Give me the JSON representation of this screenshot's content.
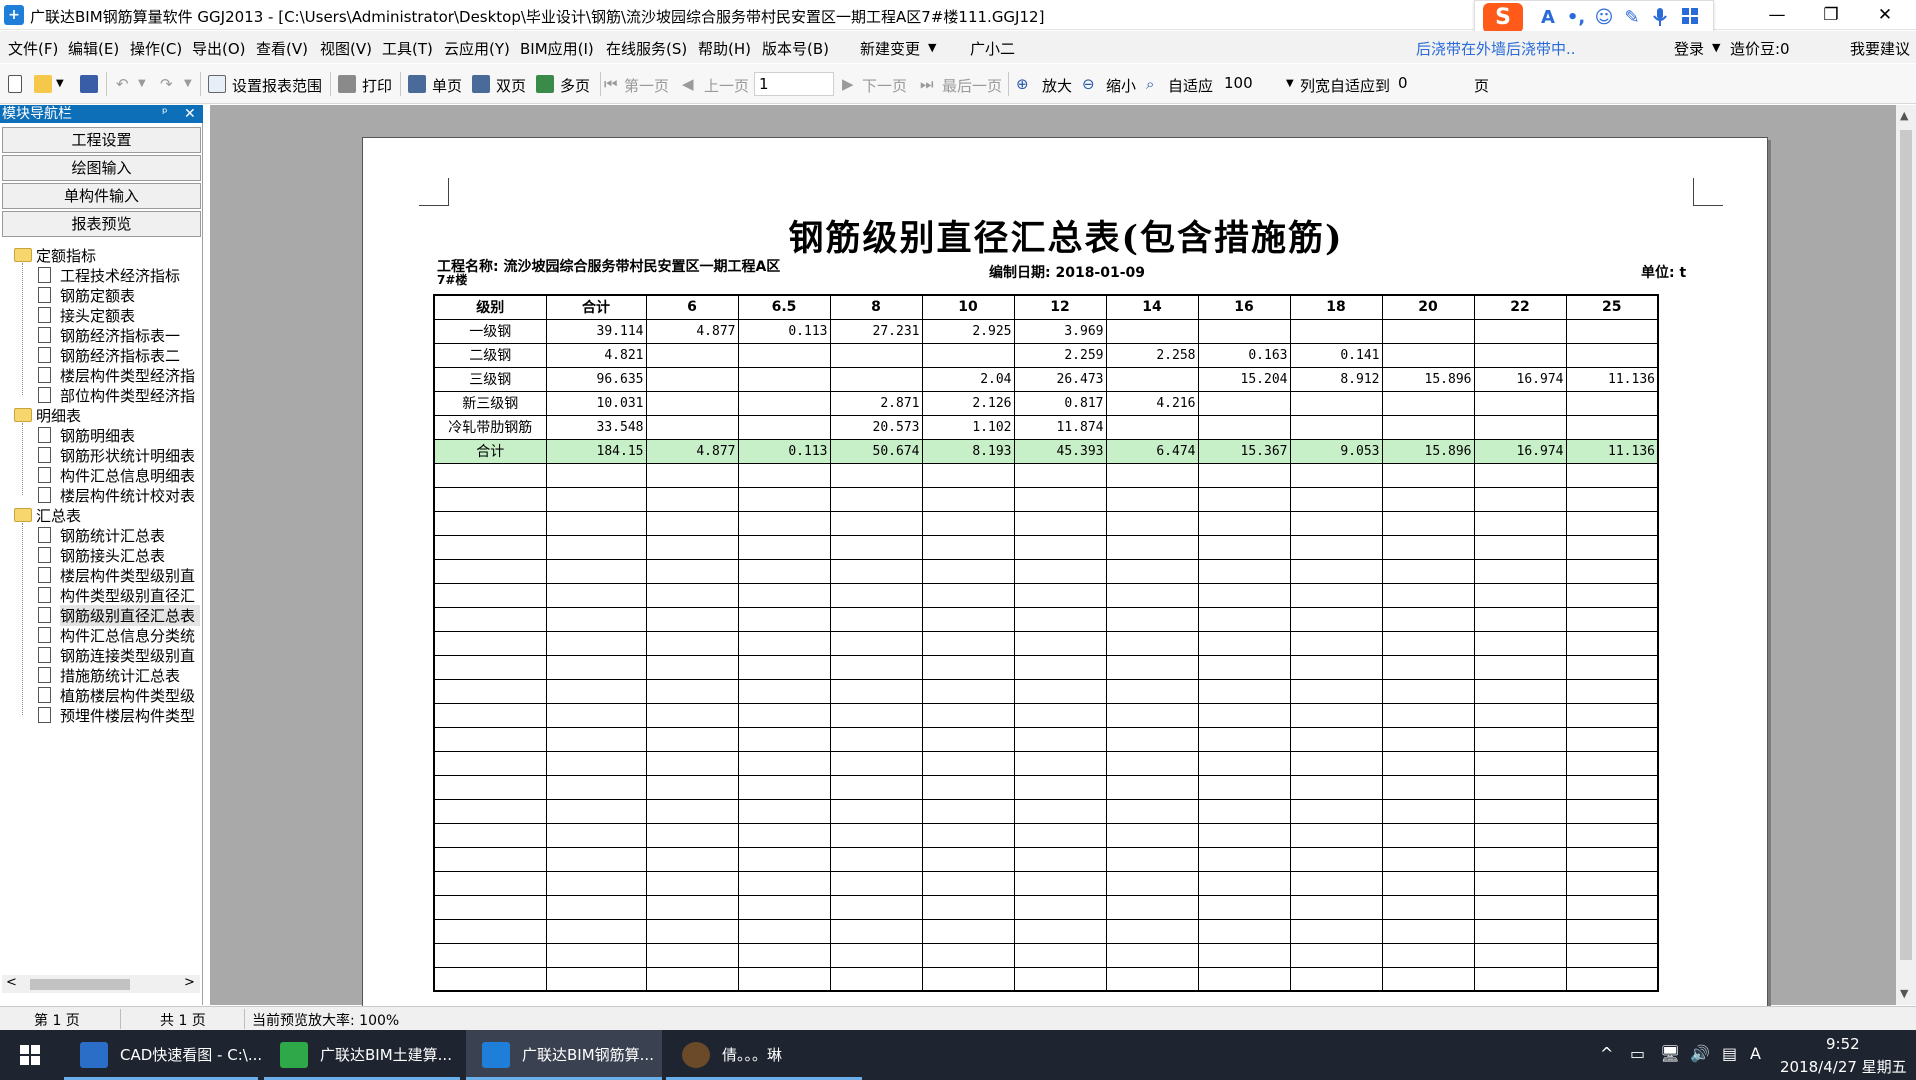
{
  "window": {
    "title": "广联达BIM钢筋算量软件 GGJ2013 - [C:\\Users\\Administrator\\Desktop\\毕业设计\\钢筋\\流沙坡园综合服务带村民安置区一期工程A区7#楼111.GGJ12]",
    "app_icon": "广联达-logo",
    "min_label": "—",
    "max_label": "❐",
    "close_label": "✕"
  },
  "ime": {
    "logo": "S",
    "icons": [
      "A",
      "•,",
      "☺",
      "✎",
      "🎤",
      "▦"
    ]
  },
  "menu": {
    "items": [
      "文件(F)",
      "编辑(E)",
      "操作(C)",
      "导出(O)",
      "查看(V)",
      "视图(V)",
      "工具(T)",
      "云应用(Y)",
      "BIM应用(I)",
      "在线服务(S)",
      "帮助(H)",
      "版本号(B)",
      "新建变更",
      "广小二"
    ],
    "notice": "后浇带在外墙后浇带中..",
    "login": "登录",
    "price_bean": "造价豆:0",
    "feedback": "我要建议"
  },
  "toolbar": {
    "set_range": "设置报表范围",
    "print": "打印",
    "single": "单页",
    "double": "双页",
    "multi": "多页",
    "first": "第一页",
    "prev": "上一页",
    "page_value": "1",
    "next": "下一页",
    "last": "最后一页",
    "zoom_in": "放大",
    "zoom_out": "缩小",
    "fit": "自适应",
    "zoom_value": "100",
    "col_fit": "列宽自适应到",
    "col_fit_value": "0",
    "page_unit": "页"
  },
  "nav": {
    "title": "模块导航栏",
    "pin": "ᵖ",
    "close": "✕",
    "buttons": [
      "工程设置",
      "绘图输入",
      "单构件输入",
      "报表预览"
    ],
    "groups": [
      {
        "label": "定额指标",
        "items": [
          "工程技术经济指标",
          "钢筋定额表",
          "接头定额表",
          "钢筋经济指标表一",
          "钢筋经济指标表二",
          "楼层构件类型经济指",
          "部位构件类型经济指"
        ]
      },
      {
        "label": "明细表",
        "items": [
          "钢筋明细表",
          "钢筋形状统计明细表",
          "构件汇总信息明细表",
          "楼层构件统计校对表"
        ]
      },
      {
        "label": "汇总表",
        "items": [
          "钢筋统计汇总表",
          "钢筋接头汇总表",
          "楼层构件类型级别直",
          "构件类型级别直径汇",
          "钢筋级别直径汇总表",
          "构件汇总信息分类统",
          "钢筋连接类型级别直",
          "措施筋统计汇总表",
          "植筋楼层构件类型级",
          "预埋件楼层构件类型"
        ]
      }
    ],
    "scroll_left": "<",
    "scroll_right": ">"
  },
  "report": {
    "title": "钢筋级别直径汇总表(包含措施筋)",
    "project_label": "工程名称: 流沙坡园综合服务带村民安置区一期工程A区",
    "project_label2": "7#楼",
    "date_label": "编制日期: 2018-01-09",
    "unit_label": "单位: t",
    "headers": [
      "级别",
      "合计",
      "6",
      "6.5",
      "8",
      "10",
      "12",
      "14",
      "16",
      "18",
      "20",
      "22",
      "25"
    ],
    "rows": [
      [
        "一级钢",
        "39.114",
        "4.877",
        "0.113",
        "27.231",
        "2.925",
        "3.969",
        "",
        "",
        "",
        "",
        "",
        ""
      ],
      [
        "二级钢",
        "4.821",
        "",
        "",
        "",
        "",
        "2.259",
        "2.258",
        "0.163",
        "0.141",
        "",
        "",
        ""
      ],
      [
        "三级钢",
        "96.635",
        "",
        "",
        "",
        "2.04",
        "26.473",
        "",
        "15.204",
        "8.912",
        "15.896",
        "16.974",
        "11.136"
      ],
      [
        "新三级钢",
        "10.031",
        "",
        "",
        "2.871",
        "2.126",
        "0.817",
        "4.216",
        "",
        "",
        "",
        "",
        ""
      ],
      [
        "冷轧带肋钢筋",
        "33.548",
        "",
        "",
        "20.573",
        "1.102",
        "11.874",
        "",
        "",
        "",
        "",
        "",
        ""
      ]
    ],
    "total_row": [
      "合计",
      "184.15",
      "4.877",
      "0.113",
      "50.674",
      "8.193",
      "45.393",
      "6.474",
      "15.367",
      "9.053",
      "15.896",
      "16.974",
      "11.136"
    ]
  },
  "status": {
    "page": "第 1 页",
    "total": "共 1 页",
    "zoom": "当前预览放大率: 100%"
  },
  "taskbar": {
    "tasks": [
      "CAD快速看图 - C:\\...",
      "广联达BIM土建算...",
      "广联达BIM钢筋算...",
      "倩。。。琳"
    ],
    "time": "9:52",
    "date": "2018/4/27 星期五",
    "tray": [
      "^",
      "▭",
      "🖥",
      "🔊",
      "▤",
      "A"
    ]
  },
  "colors": {
    "accent": "#0d6fb8",
    "total_row": "#c8f0c8",
    "preview_bg": "#a9a9a9",
    "taskbar": "#1e2430"
  }
}
